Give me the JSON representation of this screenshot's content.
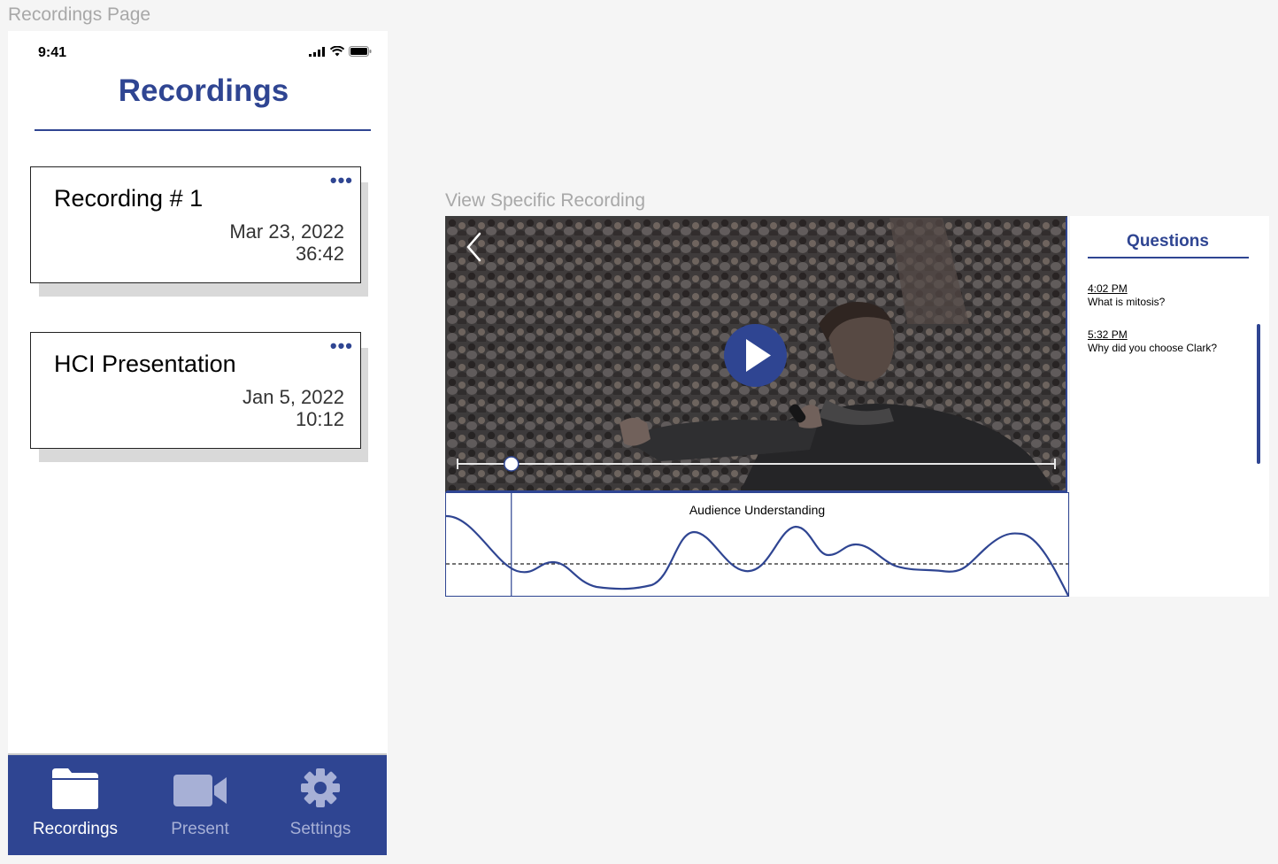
{
  "labels": {
    "recordings_page": "Recordings Page",
    "view_recording": "View Specific Recording"
  },
  "phone": {
    "status": {
      "time": "9:41"
    },
    "title": "Recordings",
    "recordings": [
      {
        "title": "Recording # 1",
        "date": "Mar 23, 2022",
        "duration": "36:42"
      },
      {
        "title": "HCI Presentation",
        "date": "Jan 5, 2022",
        "duration": "10:12"
      }
    ],
    "tabs": [
      {
        "label": "Recordings",
        "icon": "folder-icon",
        "active": true
      },
      {
        "label": "Present",
        "icon": "video-camera-icon",
        "active": false
      },
      {
        "label": "Settings",
        "icon": "gear-icon",
        "active": false
      }
    ]
  },
  "player": {
    "progress": 0.09,
    "understanding_title": "Audience Understanding"
  },
  "questions": {
    "title": "Questions",
    "items": [
      {
        "time": "4:02 PM",
        "text": "What is mitosis?"
      },
      {
        "time": "5:32 PM",
        "text": "Why did you choose Clark?"
      }
    ]
  },
  "colors": {
    "accent": "#2f4592",
    "background": "#f5f5f5"
  }
}
